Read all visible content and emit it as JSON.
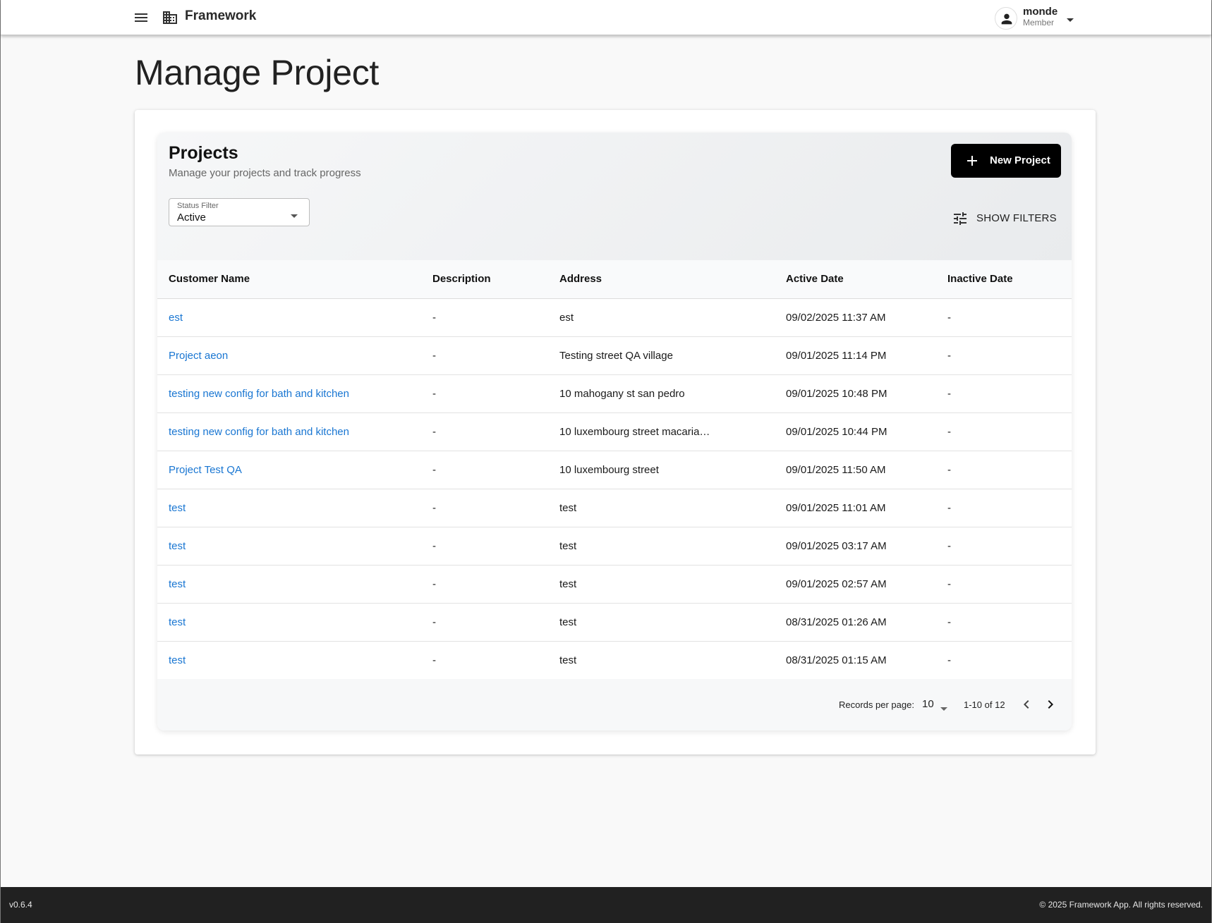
{
  "app": {
    "brand": "Framework",
    "icons": {
      "menu": "menu-icon",
      "brand": "business-icon",
      "user": "person-icon",
      "caret": "arrow-drop-down-icon"
    }
  },
  "user": {
    "name": "monde",
    "role": "Member"
  },
  "page": {
    "title": "Manage Project"
  },
  "projects_card": {
    "title": "Projects",
    "subtitle": "Manage your projects and track progress",
    "new_button": "New Project",
    "status_filter": {
      "label": "Status Filter",
      "value": "Active"
    },
    "show_filters": "SHOW FILTERS"
  },
  "table": {
    "columns": [
      "Customer Name",
      "Description",
      "Address",
      "Active Date",
      "Inactive Date"
    ],
    "rows": [
      [
        "est",
        "-",
        "est",
        "09/02/2025 11:37 AM",
        "-"
      ],
      [
        "Project aeon",
        "-",
        "Testing street QA village",
        "09/01/2025 11:14 PM",
        "-"
      ],
      [
        "testing new config for bath and kitchen",
        "-",
        "10 mahogany st san pedro",
        "09/01/2025 10:48 PM",
        "-"
      ],
      [
        "testing new config for bath and kitchen",
        "-",
        "10 luxembourg street macaria…",
        "09/01/2025 10:44 PM",
        "-"
      ],
      [
        "Project Test QA",
        "-",
        "10 luxembourg street",
        "09/01/2025 11:50 AM",
        "-"
      ],
      [
        "test",
        "-",
        "test",
        "09/01/2025 11:01 AM",
        "-"
      ],
      [
        "test",
        "-",
        "test",
        "09/01/2025 03:17 AM",
        "-"
      ],
      [
        "test",
        "-",
        "test",
        "09/01/2025 02:57 AM",
        "-"
      ],
      [
        "test",
        "-",
        "test",
        "08/31/2025 01:26 AM",
        "-"
      ],
      [
        "test",
        "-",
        "test",
        "08/31/2025 01:15 AM",
        "-"
      ]
    ]
  },
  "pagination": {
    "records_per_page_label": "Records per page:",
    "records_per_page": "10",
    "range": "1-10 of 12"
  },
  "footer": {
    "version": "v0.6.4",
    "copyright": "© 2025 Framework App. All rights reserved."
  },
  "colors": {
    "link": "#1976d2",
    "primary_button": "#000000",
    "footer_bg": "#212121"
  }
}
